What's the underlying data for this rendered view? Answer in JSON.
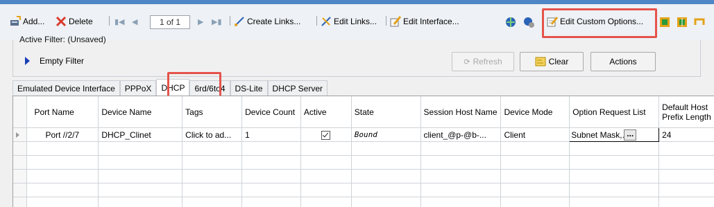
{
  "toolbar": {
    "add_label": "Add...",
    "delete_label": "Delete",
    "pager_text": "1 of 1",
    "create_links_label": "Create Links...",
    "edit_links_label": "Edit Links...",
    "edit_interface_label": "Edit Interface...",
    "edit_custom_options_label": "Edit Custom Options..."
  },
  "filter": {
    "active_filter_label": "Active Filter:  (Unsaved)",
    "empty_filter_label": "Empty Filter",
    "refresh_label": "Refresh",
    "clear_label": "Clear",
    "actions_label": "Actions"
  },
  "tabs": [
    "Emulated Device Interface",
    "PPPoX",
    "DHCP",
    "6rd/6to4",
    "DS-Lite",
    "DHCP Server"
  ],
  "grid": {
    "columns": [
      "Port Name",
      "Device Name",
      "Tags",
      "Device Count",
      "Active",
      "State",
      "Session Host Name",
      "Device Mode",
      "Option Request List",
      "Default Host Prefix Length"
    ],
    "row": {
      "port_name": "Port //2/7",
      "device_name": "DHCP_Clinet",
      "tags": "Click to ad...",
      "device_count": "1",
      "state": "Bound",
      "session_host_name": "client_@p-@b-...",
      "device_mode": "Client",
      "option_request_list": "Subnet Mask,...",
      "default_host_prefix_length": "24"
    }
  },
  "colors": {
    "highlight": "#e5534b",
    "title_bar": "#4f86c6"
  }
}
